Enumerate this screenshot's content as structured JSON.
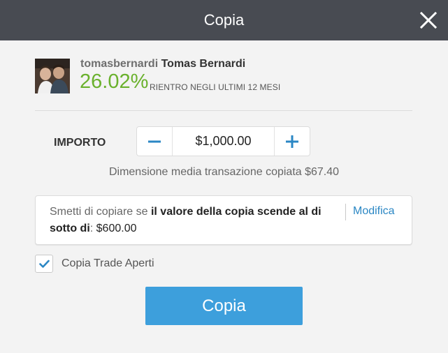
{
  "dialog": {
    "title": "Copia"
  },
  "trader": {
    "username": "tomasbernardi",
    "full_name": "Tomas Bernardi",
    "gain": "26.02%",
    "gain_caption": "RIENTRO NEGLI ULTIMI 12 MESI",
    "gain_color": "#6ab12d"
  },
  "amount": {
    "label": "IMPORTO",
    "value": "$1,000.00",
    "avg_trade_size": "Dimensione media transazione copiata $67.40"
  },
  "stop_loss": {
    "text_intro": "Smetti di copiare se ",
    "text_bold": "il valore della copia scende al di sotto di",
    "text_separator": ": ",
    "value": "$600.00",
    "edit_label": "Modifica"
  },
  "open_trades": {
    "label": "Copia Trade Aperti",
    "checked": true
  },
  "submit": {
    "label": "Copia",
    "color": "#3d9fdc"
  },
  "icons": {
    "close": "close-icon",
    "minus": "minus-icon",
    "plus": "plus-icon",
    "check": "checkmark-icon"
  }
}
